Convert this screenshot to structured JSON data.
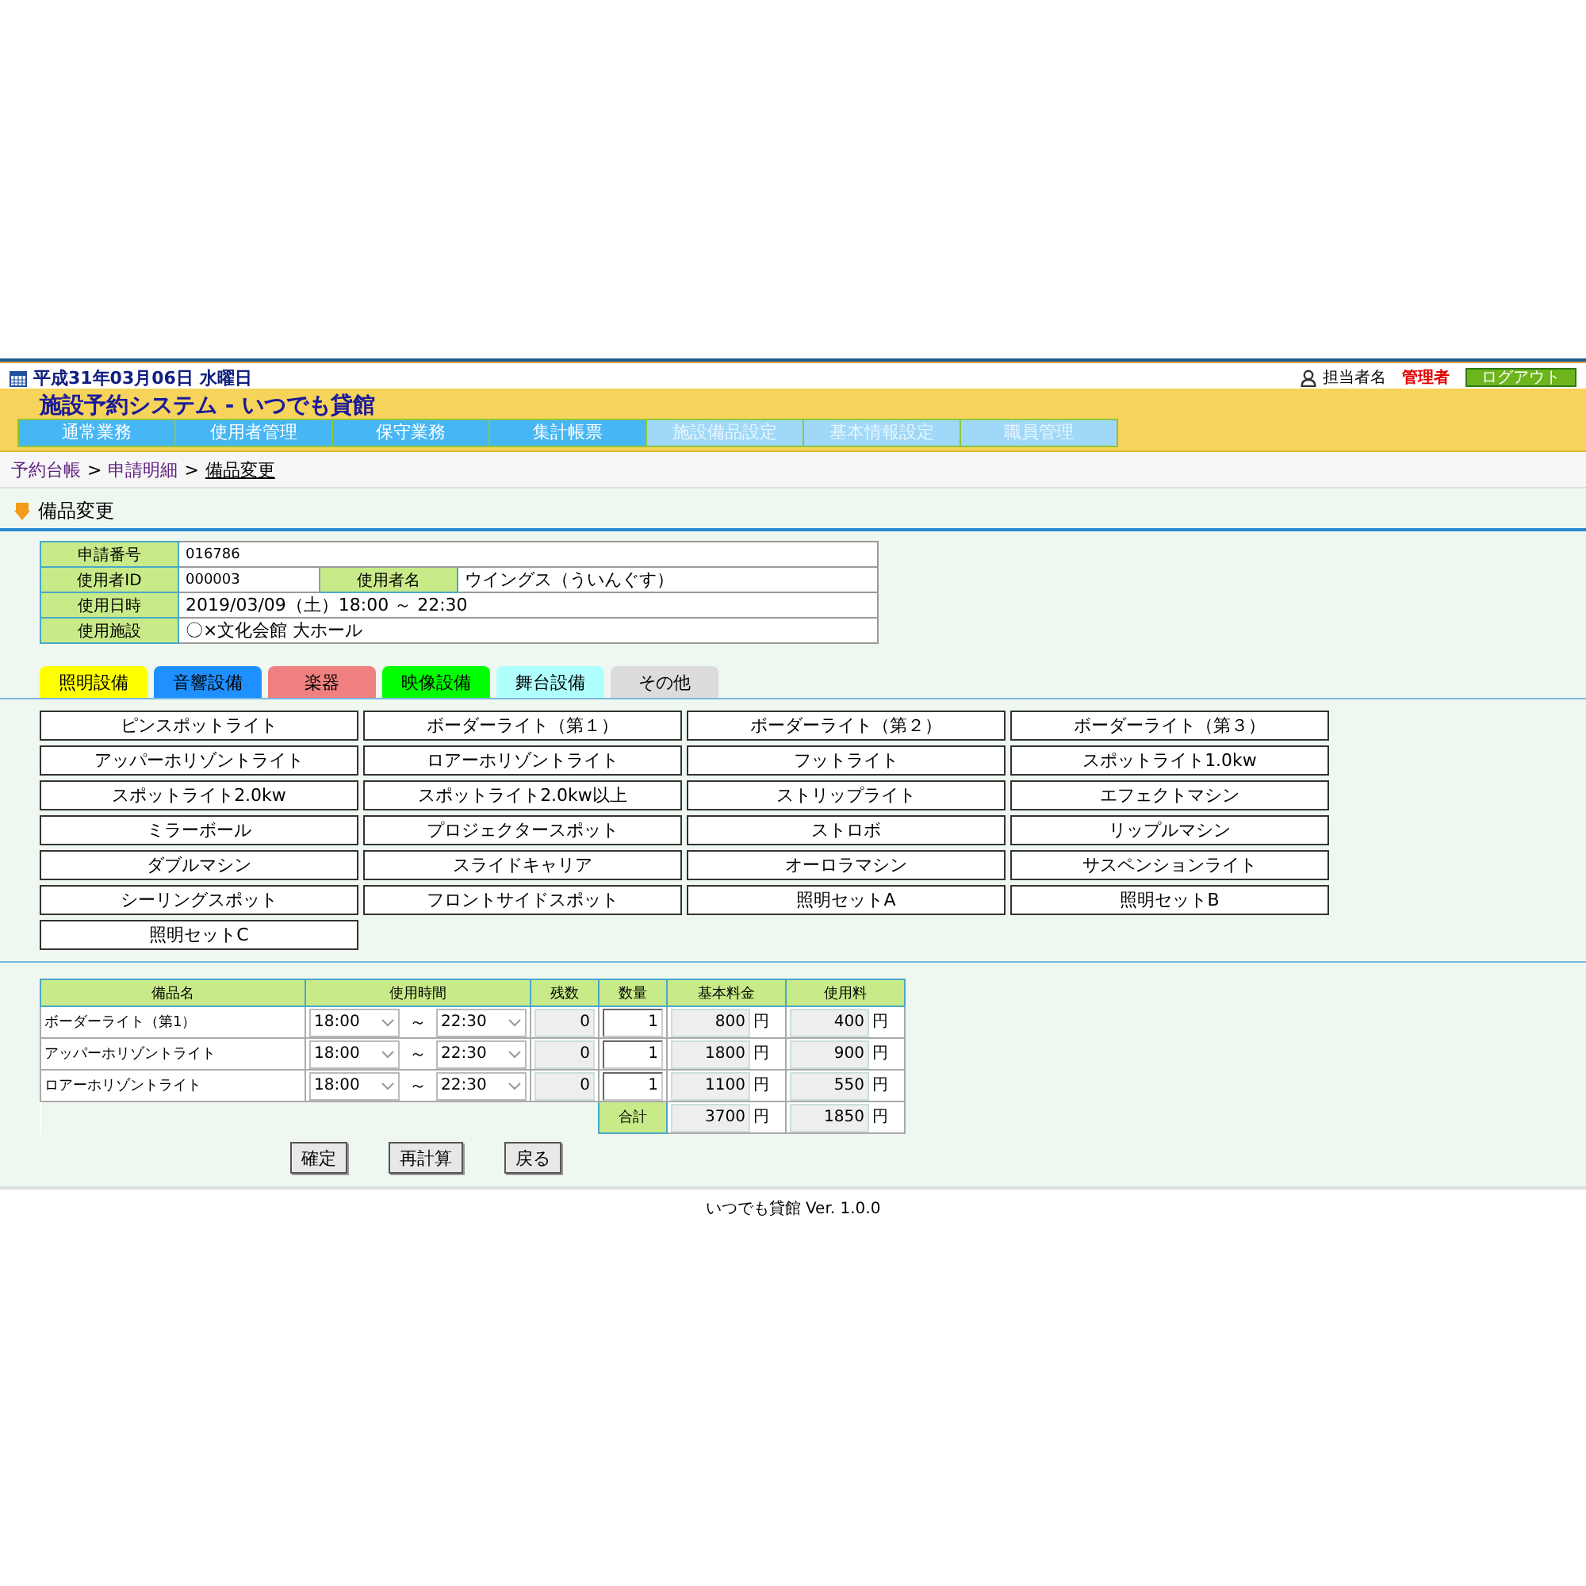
{
  "header": {
    "date": "平成31年03月06日 水曜日",
    "staff_label": "担当者名",
    "staff_name": "管理者",
    "logout": "ログアウト",
    "title": "施設予約システム - いつでも貸館"
  },
  "nav": [
    {
      "label": "通常業務",
      "disabled": false
    },
    {
      "label": "使用者管理",
      "disabled": false
    },
    {
      "label": "保守業務",
      "disabled": false
    },
    {
      "label": "集計帳票",
      "disabled": false
    },
    {
      "label": "施設備品設定",
      "disabled": true
    },
    {
      "label": "基本情報設定",
      "disabled": true
    },
    {
      "label": "職員管理",
      "disabled": true
    }
  ],
  "breadcrumb": [
    {
      "label": "予約台帳",
      "current": false
    },
    {
      "label": "申請明細",
      "current": false,
      "separator": ">"
    },
    {
      "label": "備品変更",
      "current": true,
      "separator": ">"
    }
  ],
  "section_title": "備品変更",
  "info": [
    {
      "label": "申請番号",
      "value": "016786"
    },
    {
      "label": "使用者ID",
      "value": "000003",
      "extra_label": "使用者名",
      "extra_value": "ウイングス（ういんぐす）"
    },
    {
      "label": "使用日時",
      "value": "2019/03/09（土）18:00 ～ 22:30"
    },
    {
      "label": "使用施設",
      "value": "〇×文化会館 大ホール"
    }
  ],
  "categories": [
    {
      "label": "照明設備",
      "color": "#ffff00"
    },
    {
      "label": "音響設備",
      "color": "#1e90ff"
    },
    {
      "label": "楽器",
      "color": "#f08080"
    },
    {
      "label": "映像設備",
      "color": "#00ff00"
    },
    {
      "label": "舞台設備",
      "color": "#b0ffff"
    },
    {
      "label": "その他",
      "color": "#dcdcdc"
    }
  ],
  "equipment": [
    "ピンスポットライト",
    "ボーダーライト（第１）",
    "ボーダーライト（第２）",
    "ボーダーライト（第３）",
    "アッパーホリゾントライト",
    "ロアーホリゾントライト",
    "フットライト",
    "スポットライト1.0kw",
    "スポットライト2.0kw",
    "スポットライト2.0kw以上",
    "ストリップライト",
    "エフェクトマシン",
    "ミラーボール",
    "プロジェクタースポット",
    "ストロボ",
    "リップルマシン",
    "ダブルマシン",
    "スライドキャリア",
    "オーロラマシン",
    "サスペンションライト",
    "シーリングスポット",
    "フロントサイドスポット",
    "照明セットA",
    "照明セットB",
    "照明セットC"
  ],
  "usage": {
    "columns": [
      "備品名",
      "使用時間",
      "残数",
      "数量",
      "基本料金",
      "使用料"
    ],
    "rows": [
      {
        "name": "ボーダーライト（第1）",
        "start": "18:00",
        "separator": "～",
        "end": "22:30",
        "remaining": "0",
        "quantity": "1",
        "base_fee": "800",
        "base_unit": "円",
        "fee": "400",
        "fee_unit": "円"
      },
      {
        "name": "アッパーホリゾントライト",
        "start": "18:00",
        "separator": "～",
        "end": "22:30",
        "remaining": "0",
        "quantity": "1",
        "base_fee": "1800",
        "base_unit": "円",
        "fee": "900",
        "fee_unit": "円"
      },
      {
        "name": "ロアーホリゾントライト",
        "start": "18:00",
        "separator": "～",
        "end": "22:30",
        "remaining": "0",
        "quantity": "1",
        "base_fee": "1100",
        "base_unit": "円",
        "fee": "550",
        "fee_unit": "円"
      }
    ],
    "total": {
      "label": "合計",
      "base_fee": "3700",
      "base_unit": "円",
      "fee": "1850",
      "fee_unit": "円"
    }
  },
  "buttons": [
    "確定",
    "再計算",
    "戻る"
  ],
  "footer": "いつでも貸館 Ver. 1.0.0"
}
